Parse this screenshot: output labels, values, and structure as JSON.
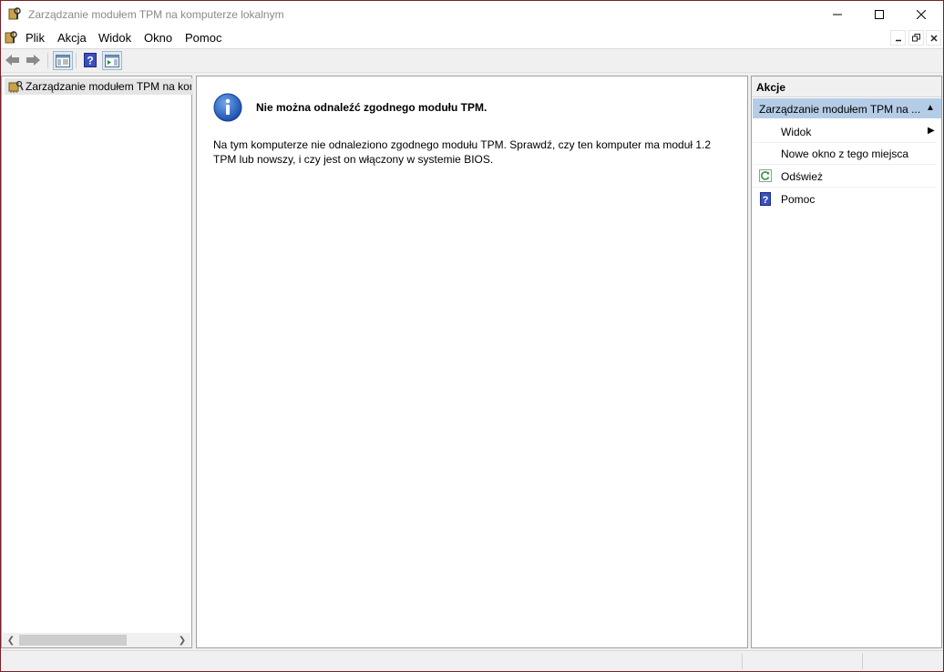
{
  "window": {
    "title": "Zarządzanie modułem TPM na komputerze lokalnym"
  },
  "menubar": {
    "items": [
      "Plik",
      "Akcja",
      "Widok",
      "Okno",
      "Pomoc"
    ]
  },
  "toolbar": {
    "icons": [
      "back-arrow-icon",
      "forward-arrow-icon",
      "show-hide-console-tree-icon",
      "help-icon",
      "show-hide-action-pane-icon"
    ]
  },
  "tree": {
    "root_label": "Zarządzanie modułem TPM na kon"
  },
  "content": {
    "message_title": "Nie można odnaleźć zgodnego modułu TPM.",
    "message_body": "Na tym komputerze nie odnaleziono zgodnego modułu TPM. Sprawdź, czy ten komputer ma moduł 1.2 TPM lub nowszy, i czy jest on włączony w systemie BIOS."
  },
  "actions": {
    "header": "Akcje",
    "group_label": "Zarządzanie modułem TPM na ...",
    "items": [
      {
        "label": "Widok",
        "has_submenu": true
      },
      {
        "label": "Nowe okno z tego miejsca"
      },
      {
        "label": "Odśwież",
        "icon": "refresh-icon"
      },
      {
        "label": "Pomoc",
        "icon": "help-icon"
      }
    ]
  },
  "colors": {
    "selected_group": "#b5cce6",
    "frame_border": "#7a1f2b",
    "info_icon_blue": "#1f5fbf"
  }
}
